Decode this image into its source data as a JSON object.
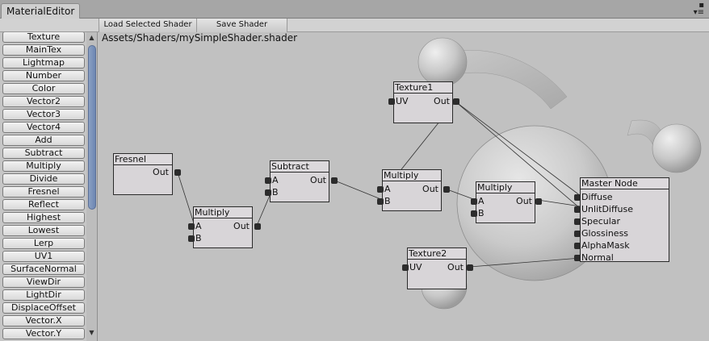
{
  "window": {
    "tab_title": "MaterialEditor",
    "icons": [
      "lock-icon",
      "menu-icon"
    ]
  },
  "toolbar": {
    "load_label": "Load Selected Shader",
    "save_label": "Save Shader"
  },
  "sidebar": {
    "items": [
      "Texture",
      "MainTex",
      "Lightmap",
      "Number",
      "Color",
      "Vector2",
      "Vector3",
      "Vector4",
      "Add",
      "Subtract",
      "Multiply",
      "Divide",
      "Fresnel",
      "Reflect",
      "Highest",
      "Lowest",
      "Lerp",
      "UV1",
      "SurfaceNormal",
      "ViewDir",
      "LightDir",
      "DisplaceOffset",
      "Vector.X",
      "Vector.Y"
    ]
  },
  "canvas": {
    "path": "Assets/Shaders/mySimpleShader.shader",
    "nodes": {
      "fresnel": {
        "title": "Fresnel",
        "out": "Out"
      },
      "multiply1": {
        "title": "Multiply",
        "a": "A",
        "b": "B",
        "out": "Out"
      },
      "subtract": {
        "title": "Subtract",
        "a": "A",
        "b": "B",
        "out": "Out"
      },
      "multiply2": {
        "title": "Multiply",
        "a": "A",
        "b": "B",
        "out": "Out"
      },
      "multiply3": {
        "title": "Multiply",
        "a": "A",
        "b": "B",
        "out": "Out"
      },
      "texture1": {
        "title": "Texture1",
        "uv": "UV",
        "out": "Out"
      },
      "texture2": {
        "title": "Texture2",
        "uv": "UV",
        "out": "Out"
      },
      "master": {
        "title": "Master Node",
        "inputs": [
          "Diffuse",
          "UnlitDiffuse",
          "Specular",
          "Glossiness",
          "AlphaMask",
          "Normal"
        ]
      }
    }
  }
}
